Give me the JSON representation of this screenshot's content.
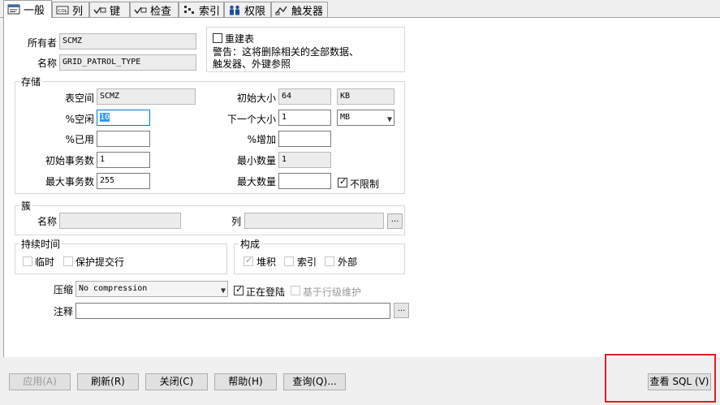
{
  "tabs": [
    {
      "label": "一般",
      "icon": "general-icon",
      "active": true
    },
    {
      "label": "列",
      "icon": "columns-icon"
    },
    {
      "label": "键",
      "icon": "keys-icon"
    },
    {
      "label": "检查",
      "icon": "check-icon"
    },
    {
      "label": "索引",
      "icon": "index-icon"
    },
    {
      "label": "权限",
      "icon": "privileges-icon"
    },
    {
      "label": "触发器",
      "icon": "triggers-icon"
    }
  ],
  "general": {
    "owner_label": "所有者",
    "owner_value": "SCMZ",
    "name_label": "名称",
    "name_value": "GRID_PATROL_TYPE",
    "rebuild_label": "重建表",
    "warning_line1": "警告：这将删除相关的全部数据、",
    "warning_line2": "触发器、外键参照"
  },
  "storage": {
    "title": "存储",
    "tablespace_label": "表空间",
    "tablespace_value": "SCMZ",
    "pctfree_label": "%空闲",
    "pctfree_value": "10",
    "pctused_label": "%已用",
    "pctused_value": "",
    "initrans_label": "初始事务数",
    "initrans_value": "1",
    "maxtrans_label": "最大事务数",
    "maxtrans_value": "255",
    "initial_label": "初始大小",
    "initial_value": "64",
    "initial_unit": "KB",
    "next_label": "下一个大小",
    "next_value": "1",
    "next_unit": "MB",
    "pctincrease_label": "%增加",
    "pctincrease_value": "",
    "minextents_label": "最小数量",
    "minextents_value": "1",
    "maxextents_label": "最大数量",
    "maxextents_value": "",
    "unlimited_label": "不限制"
  },
  "cluster": {
    "title": "簇",
    "name_label": "名称",
    "name_value": "",
    "columns_label": "列",
    "columns_value": "",
    "ellipsis": "..."
  },
  "duration": {
    "title": "持续时间",
    "temporary_label": "临时",
    "preserve_label": "保护提交行"
  },
  "organization": {
    "title": "构成",
    "heap_label": "堆积",
    "index_label": "索引",
    "external_label": "外部"
  },
  "misc": {
    "compression_label": "压缩",
    "compression_value": "No compression",
    "logging_label": "正在登陆",
    "rowmovement_label": "基于行级维护",
    "comment_label": "注释",
    "comment_value": "",
    "ellipsis": "..."
  },
  "buttons": {
    "apply": "应用(A)",
    "refresh": "刷新(R)",
    "close": "关闭(C)",
    "help": "帮助(H)",
    "query": "查询(Q)...",
    "view_sql": "查看 SQL (V)"
  },
  "colors": {
    "highlight_box": "#e02020",
    "selection": "#3399ff"
  }
}
